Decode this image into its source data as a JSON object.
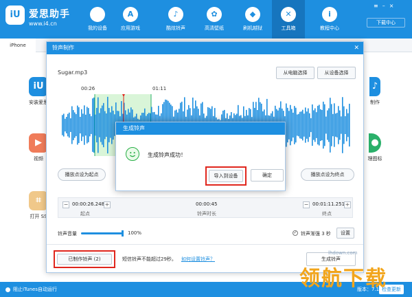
{
  "app": {
    "brand": "爱思助手",
    "url": "www.i4.cn",
    "logo_text": "iU",
    "download_center": "下载中心",
    "nav": [
      {
        "label": "我的设备",
        "icon": "apple-icon"
      },
      {
        "label": "应用游戏",
        "icon": "appstore-icon"
      },
      {
        "label": "酷炫铃声",
        "icon": "bell-icon"
      },
      {
        "label": "高清壁纸",
        "icon": "flower-icon"
      },
      {
        "label": "刷机越狱",
        "icon": "dropbox-icon"
      },
      {
        "label": "工具箱",
        "icon": "tools-icon"
      },
      {
        "label": "教程中心",
        "icon": "info-icon"
      }
    ]
  },
  "tab": {
    "iphone": "iPhone"
  },
  "tools": [
    {
      "label": "安装爱思",
      "color": "#1e8fe0"
    },
    {
      "label": "视频",
      "color": "#f07c5a"
    },
    {
      "label": "打开 SS",
      "color": "#f0c88a"
    },
    {
      "label": "制作",
      "color": "#1e8fe0"
    },
    {
      "label": "理图标",
      "color": "#2ab06a"
    }
  ],
  "ringtone": {
    "title": "铃声制作",
    "file": "Sugar.mp3",
    "from_pc": "从电脑选择",
    "from_device": "从设备选择",
    "mark_start": "00:26",
    "mark_end": "01:11",
    "set_start": "播放点设为起点",
    "set_end": "播放点设为终点",
    "start_time": "00:00:26.248",
    "start_label": "起点",
    "duration": "00:00:45",
    "duration_label": "铃声时长",
    "end_time": "00:01:11.251",
    "end_label": "终点",
    "volume_label": "铃声音量",
    "volume_pct": "100%",
    "volume": 1.0,
    "fade_label": "铃声渐强 3 秒",
    "settings": "设置",
    "made_btn": "已制作铃声 (2)",
    "limit_note": "短信铃声不能超过29秒。",
    "howto": "如何设置铃声？",
    "generate": "生成铃声"
  },
  "success_dialog": {
    "title": "生成铃声",
    "message": "生成铃声成功！",
    "import_btn": "导入到设备",
    "confirm_btn": "确定"
  },
  "status": {
    "itunes": "阻止iTunes自动运行",
    "version": "版本：7.11",
    "update": "检查更新"
  },
  "watermark": {
    "url": "lhdown.com",
    "text": "领航下载"
  }
}
